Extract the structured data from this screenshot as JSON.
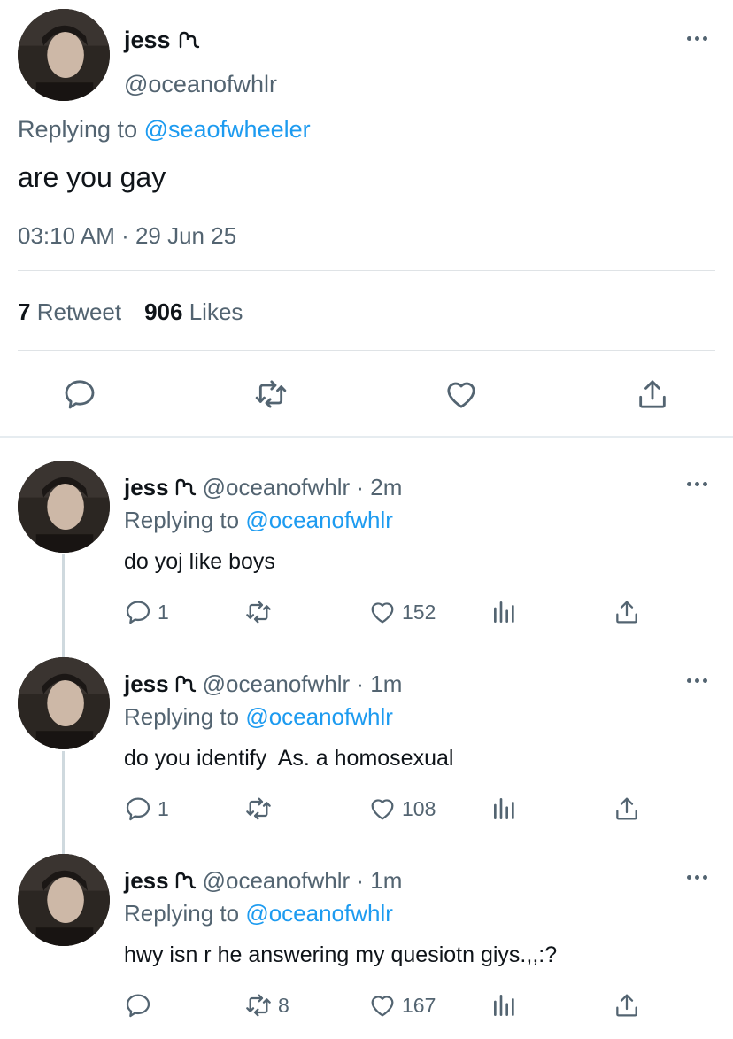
{
  "main_tweet": {
    "display_name": "jess",
    "handle": "@oceanofwhlr",
    "replying_prefix": "Replying to ",
    "replying_to": "@seaofwheeler",
    "text": "are you gay",
    "timestamp": "03:10 AM · 29 Jun 25",
    "retweet_count": "7",
    "retweet_label": "Retweet",
    "likes_count": "906",
    "likes_label": "Likes",
    "icons": [
      "reply-icon",
      "retweet-icon",
      "like-icon",
      "share-icon"
    ]
  },
  "replies": [
    {
      "display_name": "jess",
      "handle_time": "@oceanofwhlr · 2m",
      "replying_prefix": "Replying to ",
      "replying_to": "@oceanofwhlr",
      "text": "do yoj like boys",
      "reply_count": "1",
      "retweet_count": "",
      "like_count": "152"
    },
    {
      "display_name": "jess",
      "handle_time": "@oceanofwhlr · 1m",
      "replying_prefix": "Replying to ",
      "replying_to": "@oceanofwhlr",
      "text": "do you identify  As. a homosexual",
      "reply_count": "1",
      "retweet_count": "",
      "like_count": "108"
    },
    {
      "display_name": "jess",
      "handle_time": "@oceanofwhlr · 1m",
      "replying_prefix": "Replying to ",
      "replying_to": "@oceanofwhlr",
      "text": "hwy isn r he answering my quesiotn giys.,,:?",
      "reply_count": "",
      "retweet_count": "8",
      "like_count": "167"
    }
  ],
  "colors": {
    "link": "#1d9bf0",
    "secondary_text": "#536471",
    "primary_text": "#0f1419",
    "divider": "#dfe3e6"
  }
}
